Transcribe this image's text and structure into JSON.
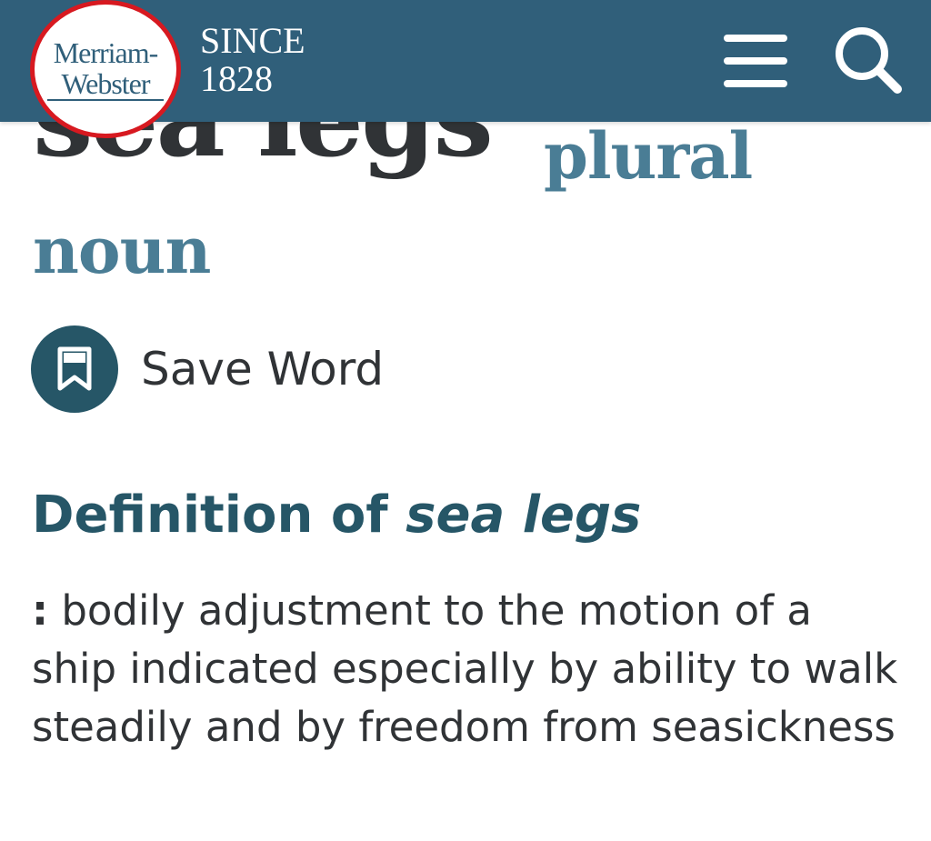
{
  "header": {
    "logo_line1": "Merriam-",
    "logo_line2": "Webster",
    "since_line1": "SINCE",
    "since_line2": "1828",
    "menu_icon": "hamburger-menu-icon",
    "search_icon": "search-icon",
    "colors": {
      "bar": "#305f7a",
      "logo_ring": "#d71920"
    }
  },
  "entry": {
    "headword": "sea legs",
    "fl_plural": "plural",
    "fl_noun": "noun",
    "save_label": "Save Word",
    "save_icon": "bookmark-icon"
  },
  "definition": {
    "heading_prefix": "Definition of",
    "heading_term": "sea legs",
    "colon": ":",
    "text": "bodily adjustment to the motion of a ship indicated especially by ability to walk steadily and by freedom from seasickness"
  }
}
